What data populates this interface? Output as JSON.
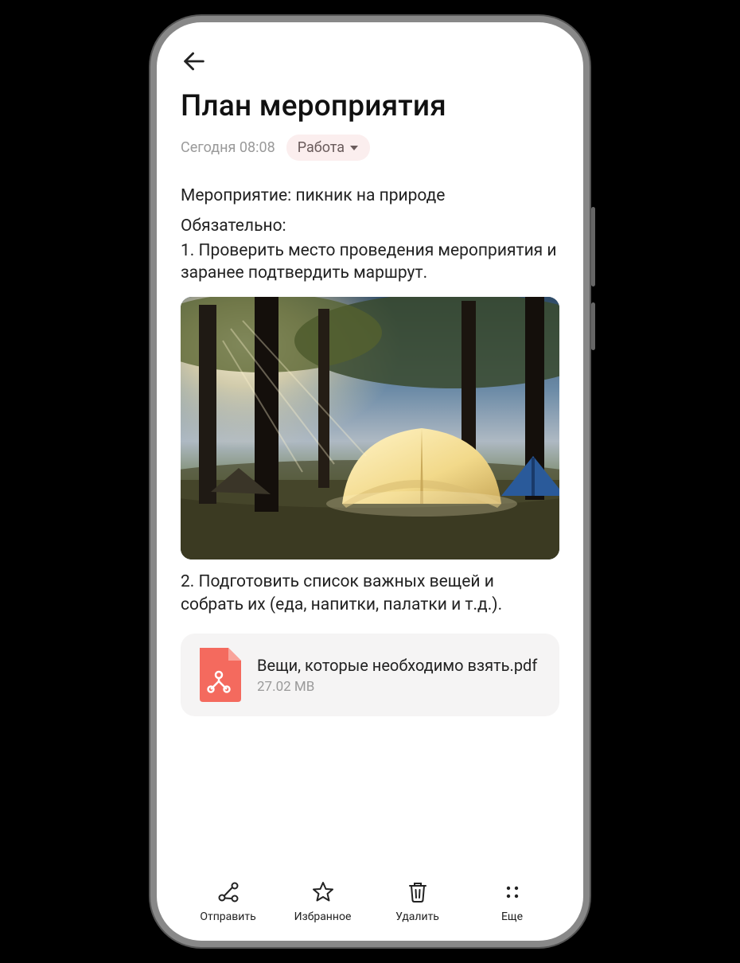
{
  "header": {
    "title": "План мероприятия",
    "timestamp": "Сегодня 08:08",
    "tag_label": "Работа"
  },
  "note": {
    "line_event": "Мероприятие: пикник на природе",
    "line_must": "Обязательно:",
    "item1": "1. Проверить место проведения мероприятия и заранее подтвердить маршрут.",
    "item2": "2. Подготовить список важных вещей и собрать их (еда, напитки, палатки и т.д.)."
  },
  "attachment": {
    "filename": "Вещи, которые необходимо взять.pdf",
    "size": "27.02 MB"
  },
  "bottom": {
    "send": "Отправить",
    "favorite": "Избранное",
    "delete": "Удалить",
    "more": "Еще"
  }
}
